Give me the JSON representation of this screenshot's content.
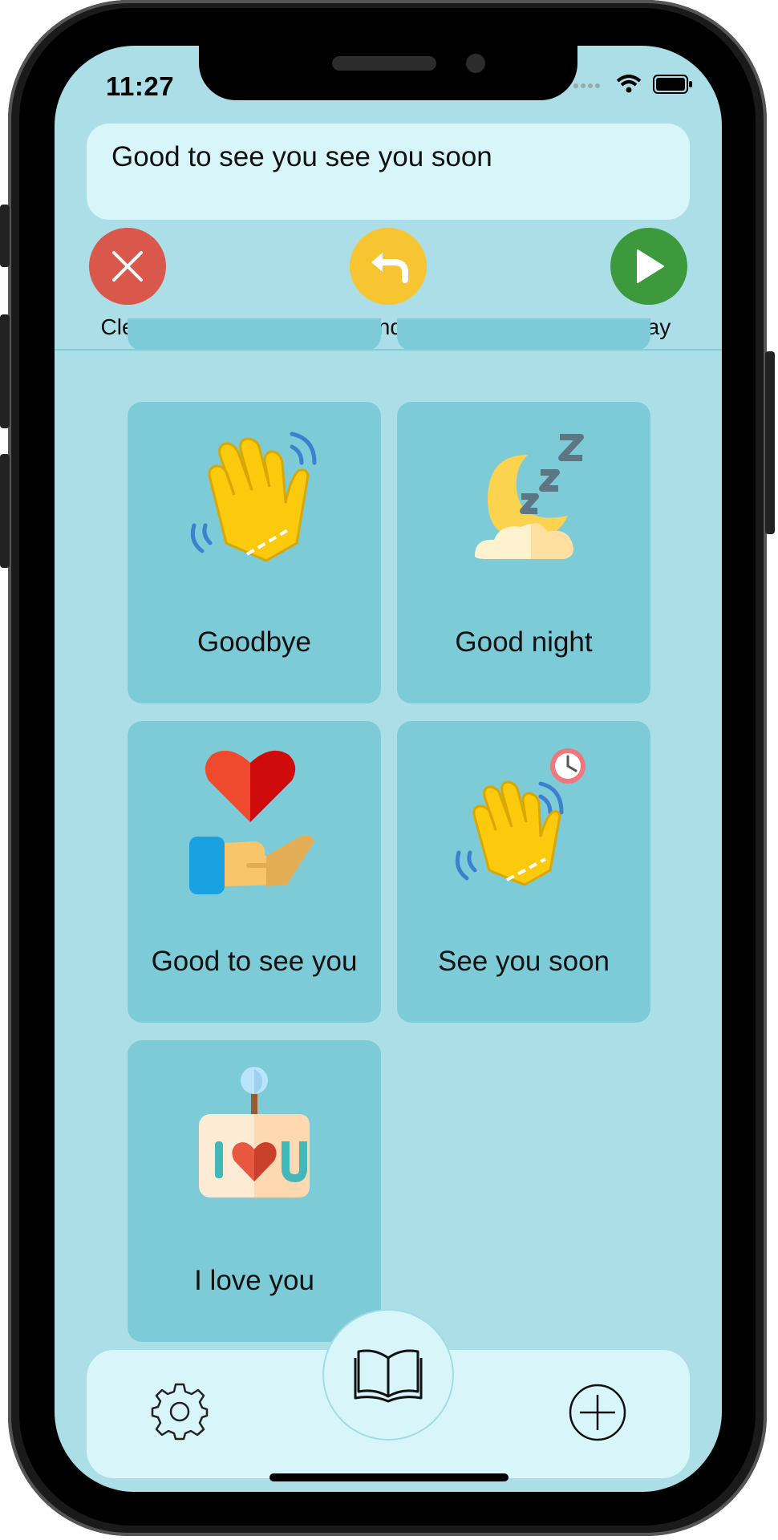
{
  "status": {
    "time": "11:27"
  },
  "sentence": {
    "text": "Good to see you see you soon"
  },
  "actions": {
    "clear": {
      "label": "Clear",
      "color": "#d9544a"
    },
    "undo": {
      "label": "Undo",
      "color": "#f6c531"
    },
    "play": {
      "label": "Play",
      "color": "#3c9a3c"
    }
  },
  "tiles": [
    {
      "label": "Goodbye",
      "icon": "waving-hand-icon"
    },
    {
      "label": "Good night",
      "icon": "moon-sleep-icon"
    },
    {
      "label": "Good to see you",
      "icon": "heart-hand-icon"
    },
    {
      "label": "See you soon",
      "icon": "waving-hand-clock-icon"
    },
    {
      "label": "I love you",
      "icon": "i-love-you-sign-icon"
    }
  ],
  "nav": {
    "settings": {
      "icon": "gear-icon"
    },
    "library": {
      "icon": "open-book-icon"
    },
    "add": {
      "icon": "plus-circle-icon"
    }
  },
  "colors": {
    "screen_bg": "#abdee6",
    "tile_bg": "#7ccbd6",
    "panel_bg": "#d8f6fa"
  }
}
